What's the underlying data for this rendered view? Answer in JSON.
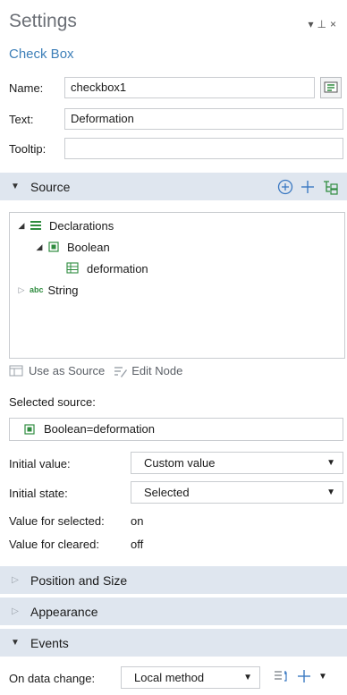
{
  "header": {
    "title": "Settings",
    "subtitle": "Check Box",
    "window_controls": "▾ ⊥ ×"
  },
  "fields": {
    "name_label": "Name:",
    "name_value": "checkbox1",
    "text_label": "Text:",
    "text_value": "Deformation",
    "tooltip_label": "Tooltip:",
    "tooltip_value": ""
  },
  "sections": {
    "source": "Source",
    "position_size": "Position and Size",
    "appearance": "Appearance",
    "events": "Events"
  },
  "tree": {
    "declarations": "Declarations",
    "boolean": "Boolean",
    "deformation": "deformation",
    "string_tag": "abc",
    "string": "String"
  },
  "source_toolbar": {
    "use_as_source": "Use as Source",
    "edit_node": "Edit Node"
  },
  "selected_source": {
    "label": "Selected source:",
    "value": "Boolean=deformation"
  },
  "initial_value": {
    "label": "Initial value:",
    "selected": "Custom value"
  },
  "initial_state": {
    "label": "Initial state:",
    "selected": "Selected"
  },
  "value_selected": {
    "label": "Value for selected:",
    "value": "on"
  },
  "value_cleared": {
    "label": "Value for cleared:",
    "value": "off"
  },
  "events": {
    "on_data_change_label": "On data change:",
    "on_data_change_value": "Local method"
  },
  "colors": {
    "section_bg": "#dfe6ef",
    "accent": "#2f8c3f",
    "subtitle": "#3d7fb8"
  }
}
